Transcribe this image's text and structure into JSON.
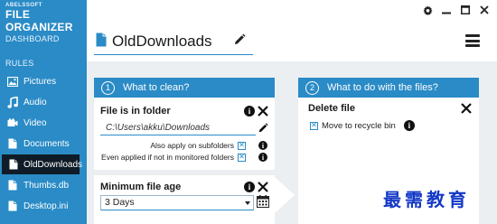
{
  "app": {
    "brand_small": "ABELSSOFT",
    "brand_big": "FILE ORGANIZER"
  },
  "sidebar": {
    "dashboard": "DASHBOARD",
    "rules_header": "RULES",
    "items": [
      {
        "label": "Pictures",
        "icon": "picture-icon"
      },
      {
        "label": "Audio",
        "icon": "music-note-icon"
      },
      {
        "label": "Video",
        "icon": "video-camera-icon"
      },
      {
        "label": "Documents",
        "icon": "document-icon"
      },
      {
        "label": "OldDownloads",
        "icon": "document-icon",
        "active": true
      },
      {
        "label": "Thumbs.db",
        "icon": "document-icon"
      },
      {
        "label": "Desktop.ini",
        "icon": "document-icon"
      }
    ]
  },
  "header": {
    "rule_name": "OldDownloads"
  },
  "what_to_clean": {
    "step": "1",
    "title": "What to clean?",
    "folder_condition": {
      "title": "File is in folder",
      "path": "C:\\Users\\akku\\Downloads",
      "option1": "Also apply on subfolders",
      "option2": "Even applied if not in monitored folders"
    },
    "age_condition": {
      "title": "Minimum file age",
      "value": "3 Days"
    }
  },
  "what_to_do": {
    "step": "2",
    "title": "What to do with the files?",
    "action": {
      "title": "Delete file",
      "option": "Move to recycle bin"
    }
  },
  "watermark": "最需教育",
  "colors": {
    "accent": "#2a8bc6",
    "active_item": "#0f1b26",
    "workarea": "#eceff1"
  }
}
